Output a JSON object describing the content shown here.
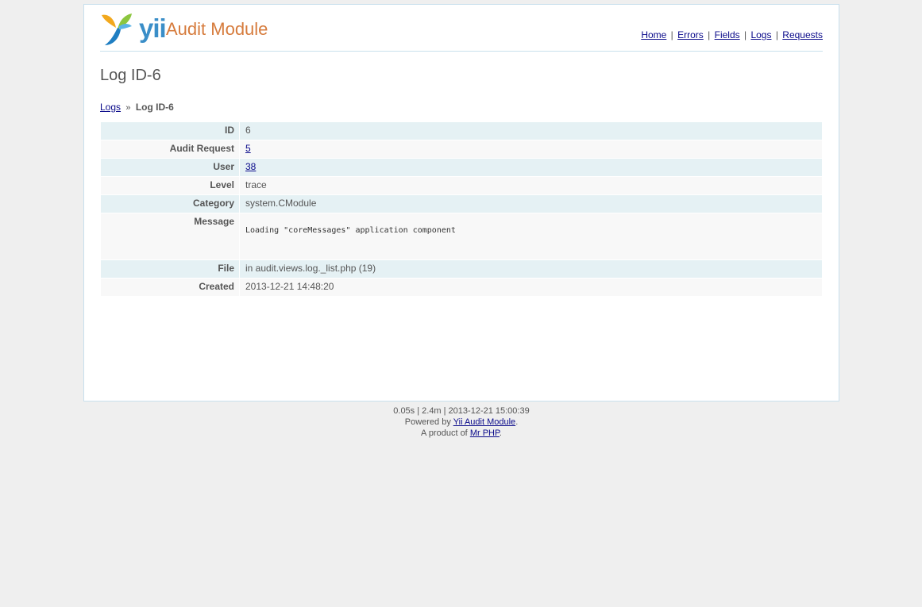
{
  "header": {
    "logo_yii": "yii",
    "logo_text": "Audit Module",
    "menu": [
      {
        "label": "Home"
      },
      {
        "label": "Errors"
      },
      {
        "label": "Fields"
      },
      {
        "label": "Logs"
      },
      {
        "label": "Requests"
      }
    ],
    "separator": "|"
  },
  "page_title": "Log ID-6",
  "breadcrumbs": {
    "parent": "Logs",
    "separator": "»",
    "current": "Log ID-6"
  },
  "detail": {
    "rows": [
      {
        "label": "ID",
        "value": "6",
        "link": false
      },
      {
        "label": "Audit Request",
        "value": "5",
        "link": true
      },
      {
        "label": "User",
        "value": "38",
        "link": true
      },
      {
        "label": "Level",
        "value": "trace",
        "link": false
      },
      {
        "label": "Category",
        "value": "system.CModule",
        "link": false
      },
      {
        "label": "Message",
        "value": "Loading \"coreMessages\" application component",
        "link": false
      },
      {
        "label": "File",
        "value": "in audit.views.log._list.php (19)",
        "link": false
      },
      {
        "label": "Created",
        "value": "2013-12-21 14:48:20",
        "link": false
      }
    ]
  },
  "footer": {
    "stats": "0.05s | 2.4m | 2013-12-21 15:00:39",
    "powered_prefix": "Powered by",
    "powered_link": "Yii Audit Module",
    "powered_suffix": ".",
    "product_prefix": "A product of",
    "product_link": "Mr PHP",
    "product_suffix": "."
  },
  "colors": {
    "background": "#efefef",
    "row_odd": "#e5f1f4",
    "row_even": "#f8f8f8",
    "link": "#0a0a8a",
    "logo_blue": "#3a8ec8",
    "logo_orange": "#d67b3c"
  }
}
